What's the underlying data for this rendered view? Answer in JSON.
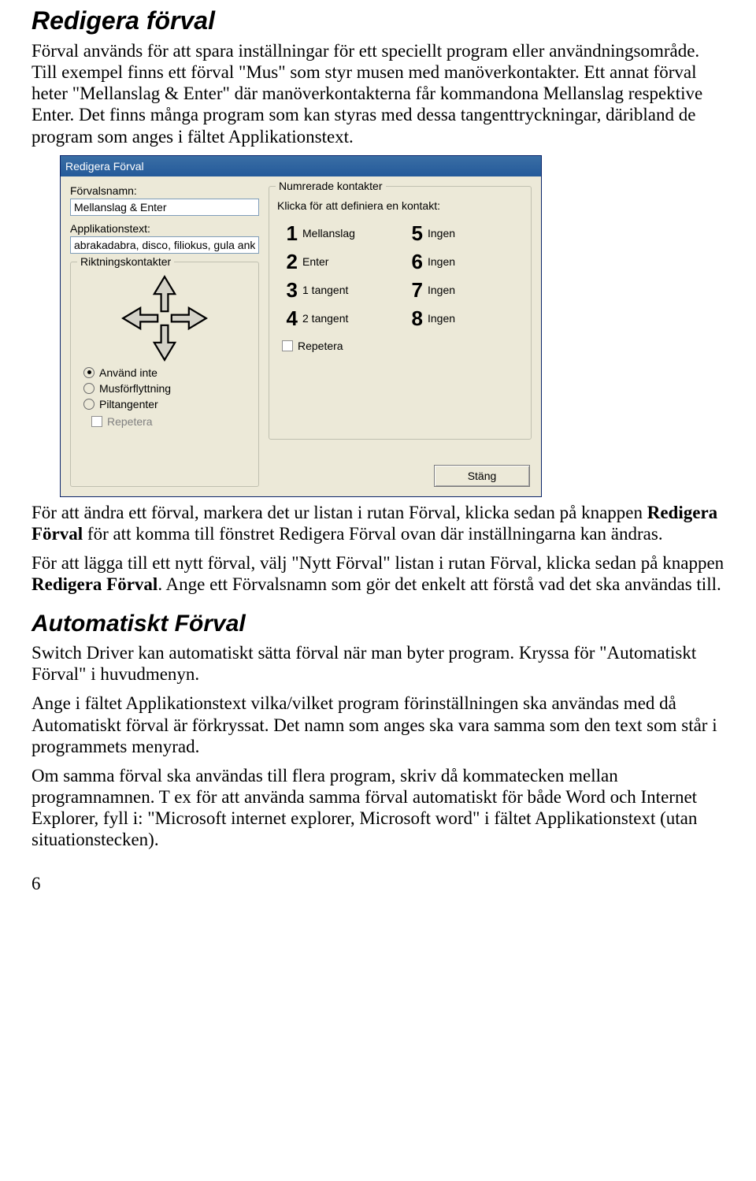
{
  "doc": {
    "h1": "Redigera förval",
    "p1": "Förval används för att spara inställningar för ett speciellt program eller användningsområde. Till exempel finns ett förval \"Mus\" som styr musen med manöverkontakter. Ett annat förval heter \"Mellanslag & Enter\" där manöverkontakterna får kommandona Mellanslag respektive Enter. Det finns många program som kan styras med dessa tangenttryckningar, däribland de program som anges i fältet Applikationstext.",
    "p2a": "För att ändra ett förval, markera det ur listan i rutan Förval, klicka sedan på knappen ",
    "p2b_bold": "Redigera Förval",
    "p2c": " för att komma till fönstret Redigera Förval ovan där inställningarna kan ändras.",
    "p3a": "För att lägga till ett nytt förval, välj \"Nytt Förval\" listan i rutan Förval, klicka sedan på knappen ",
    "p3b_bold": "Redigera Förval",
    "p3c": ". Ange ett Förvalsnamn som gör det enkelt att förstå vad det ska användas till.",
    "h2": "Automatiskt Förval",
    "p4": "Switch Driver kan automatiskt sätta förval när man byter program. Kryssa för \"Automatiskt Förval\" i huvudmenyn.",
    "p5": "Ange i fältet Applikationstext vilka/vilket program förinställningen ska användas med då Automatiskt förval är förkryssat. Det namn som anges ska vara samma som den text som står i programmets menyrad.",
    "p6": "Om samma förval ska användas till flera program, skriv då kommatecken mellan programnamnen. T ex för att använda samma förval automatiskt för både Word och Internet Explorer, fyll i: \"Microsoft internet explorer, Microsoft word\" i fältet Applikationstext (utan situationstecken).",
    "pagenum": "6"
  },
  "dialog": {
    "title": "Redigera Förval",
    "lbl_name": "Förvalsnamn:",
    "val_name": "Mellanslag & Enter",
    "lbl_app": "Applikationstext:",
    "val_app": "abrakadabra, disco, filiokus, gula ank",
    "gb_dir": "Riktningskontakter",
    "radio_none": "Använd inte",
    "radio_mouse": "Musförflyttning",
    "radio_arrows": "Piltangenter",
    "chk_repeat_disabled": "Repetera",
    "gb_num": "Numrerade kontakter",
    "num_hint": "Klicka för att definiera en kontakt:",
    "contacts": [
      {
        "n": "1",
        "lbl": "Mellanslag"
      },
      {
        "n": "2",
        "lbl": "Enter"
      },
      {
        "n": "3",
        "lbl": "1 tangent"
      },
      {
        "n": "4",
        "lbl": "2 tangent"
      },
      {
        "n": "5",
        "lbl": "Ingen"
      },
      {
        "n": "6",
        "lbl": "Ingen"
      },
      {
        "n": "7",
        "lbl": "Ingen"
      },
      {
        "n": "8",
        "lbl": "Ingen"
      }
    ],
    "chk_repeat": "Repetera",
    "btn_close": "Stäng"
  }
}
